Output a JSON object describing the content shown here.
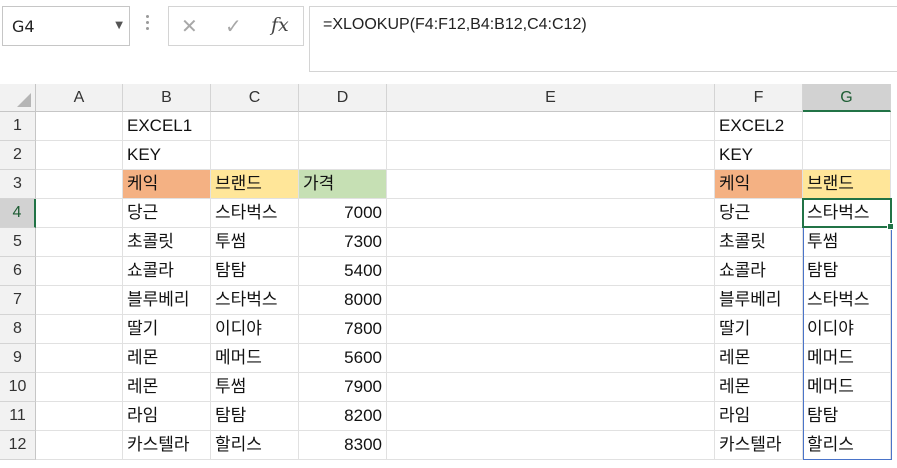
{
  "name_box": {
    "value": "G4"
  },
  "formula_bar": {
    "cancel_icon": "close-icon",
    "enter_icon": "check-icon",
    "fx_label": "fx",
    "formula": "=XLOOKUP(F4:F12,B4:B12,C4:C12)"
  },
  "columns": [
    "A",
    "B",
    "C",
    "D",
    "E",
    "F",
    "G"
  ],
  "selected_column": "G",
  "rows": [
    "1",
    "2",
    "3",
    "4",
    "5",
    "6",
    "7",
    "8",
    "9",
    "10",
    "11",
    "12"
  ],
  "selected_row": "4",
  "colors": {
    "header_orange": "#f4b183",
    "header_yellow": "#ffe699",
    "header_green": "#c6e0b4",
    "selection": "#217346",
    "spill": "#4a74c9"
  },
  "cells": {
    "B1": "EXCEL1",
    "B2": "KEY",
    "B3": "케익",
    "C3": "브랜드",
    "D3": "가격",
    "B4": "당근",
    "C4": "스타벅스",
    "D4": "7000",
    "B5": "초콜릿",
    "C5": "투썸",
    "D5": "7300",
    "B6": "쇼콜라",
    "C6": "탐탐",
    "D6": "5400",
    "B7": "블루베리",
    "C7": "스타벅스",
    "D7": "8000",
    "B8": "딸기",
    "C8": "이디야",
    "D8": "7800",
    "B9": "레몬",
    "C9": "메머드",
    "D9": "5600",
    "B10": "레몬",
    "C10": "투썸",
    "D10": "7900",
    "B11": "라임",
    "C11": "탐탐",
    "D11": "8200",
    "B12": "카스텔라",
    "C12": "할리스",
    "D12": "8300",
    "F1": "EXCEL2",
    "F2": "KEY",
    "F3": "케익",
    "G3": "브랜드",
    "F4": "당근",
    "G4": "스타벅스",
    "F5": "초콜릿",
    "G5": "투썸",
    "F6": "쇼콜라",
    "G6": "탐탐",
    "F7": "블루베리",
    "G7": "스타벅스",
    "F8": "딸기",
    "G8": "이디야",
    "F9": "레몬",
    "G9": "메머드",
    "F10": "레몬",
    "G10": "메머드",
    "F11": "라임",
    "G11": "탐탐",
    "F12": "카스텔라",
    "G12": "할리스"
  }
}
